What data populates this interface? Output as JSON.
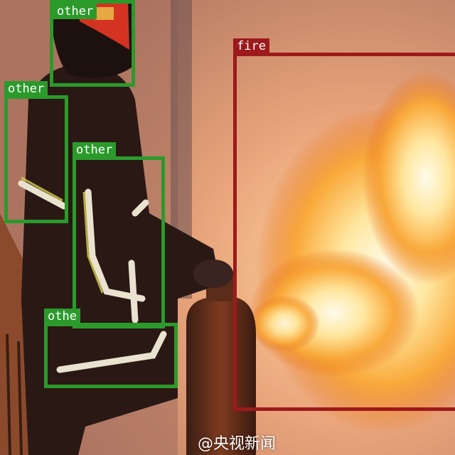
{
  "image": {
    "description_colors": {
      "wall": "#c98f6e",
      "flame_core": "#fff6d8",
      "flame_outer": "#f28a1c",
      "box_other": "#2b9a2b",
      "box_fire": "#9d1a1c"
    }
  },
  "detections": [
    {
      "label": "fire"
    },
    {
      "label": "other"
    },
    {
      "label": "other"
    },
    {
      "label": "other"
    },
    {
      "label": "othe"
    }
  ],
  "watermark": "@央视新闻"
}
